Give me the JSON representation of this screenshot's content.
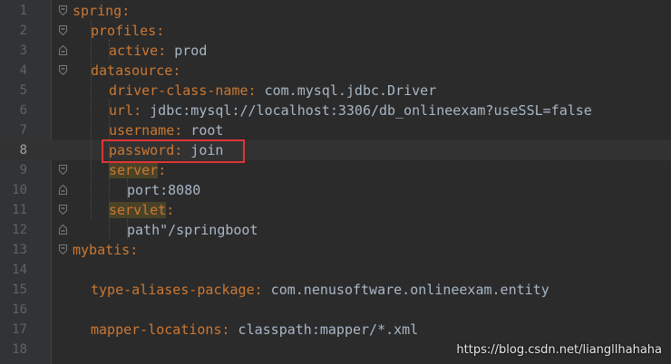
{
  "lines": [
    {
      "n": "1",
      "indent": 0,
      "key": "spring",
      "colon": ":",
      "value": "",
      "fold": "open"
    },
    {
      "n": "2",
      "indent": 1,
      "key": "profiles",
      "colon": ":",
      "value": "",
      "fold": "open"
    },
    {
      "n": "3",
      "indent": 2,
      "key": "active",
      "colon": ":",
      "value": " prod",
      "fold": "end"
    },
    {
      "n": "4",
      "indent": 1,
      "key": "datasource",
      "colon": ":",
      "value": "",
      "fold": "open"
    },
    {
      "n": "5",
      "indent": 2,
      "key": "driver-class-name",
      "colon": ":",
      "value": " com.mysql.jdbc.Driver",
      "fold": ""
    },
    {
      "n": "6",
      "indent": 2,
      "key": "url",
      "colon": ":",
      "value": " jdbc:mysql://localhost:3306/db_onlineexam?useSSL=false",
      "fold": ""
    },
    {
      "n": "7",
      "indent": 2,
      "key": "username",
      "colon": ":",
      "value": " root",
      "fold": ""
    },
    {
      "n": "8",
      "indent": 2,
      "key": "password",
      "colon": ":",
      "value": " join",
      "fold": "",
      "current": true
    },
    {
      "n": "9",
      "indent": 2,
      "key": "server",
      "colon": ":",
      "value": "",
      "fold": "open",
      "hlkey": true
    },
    {
      "n": "10",
      "indent": 3,
      "key": "",
      "colon": "",
      "value": "port:8080",
      "fold": "end"
    },
    {
      "n": "11",
      "indent": 2,
      "key": "servlet",
      "colon": ":",
      "value": "",
      "fold": "open",
      "hlkey": true
    },
    {
      "n": "12",
      "indent": 3,
      "key": "",
      "colon": "",
      "value": "path\"/springboot",
      "fold": "end"
    },
    {
      "n": "13",
      "indent": 0,
      "key": "mybatis",
      "colon": ":",
      "value": "",
      "fold": "open"
    },
    {
      "n": "14",
      "indent": 0,
      "key": "",
      "colon": "",
      "value": "",
      "fold": ""
    },
    {
      "n": "15",
      "indent": 1,
      "key": "type-aliases-package",
      "colon": ":",
      "value": " com.nenusoftware.onlineexam.entity",
      "fold": ""
    },
    {
      "n": "16",
      "indent": 0,
      "key": "",
      "colon": "",
      "value": "",
      "fold": ""
    },
    {
      "n": "17",
      "indent": 1,
      "key": "mapper-locations",
      "colon": ":",
      "value": " classpath:mapper/*.xml",
      "fold": ""
    },
    {
      "n": "18",
      "indent": 0,
      "key": "",
      "colon": "",
      "value": "",
      "fold": ""
    }
  ],
  "watermark": "https://blog.csdn.net/liangllhahaha",
  "colors": {
    "key": "#cc7832",
    "text": "#a9b7c6",
    "background": "#2b2b2b",
    "highlight_box": "#e03535"
  }
}
